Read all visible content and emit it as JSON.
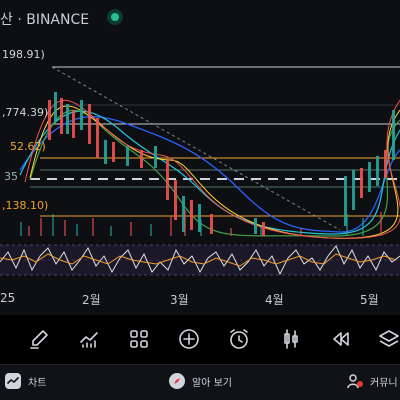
{
  "header": {
    "exchange": "산 · BINANCE"
  },
  "price_levels": [
    {
      "label": "198.91)",
      "color": "#d1d4dc"
    },
    {
      "label": ",774.39)",
      "color": "#d1d4dc"
    },
    {
      "label": "52.62)",
      "color": "#f0a030"
    },
    {
      "label": "35",
      "color": "#8fb7a0"
    },
    {
      "label": ",138.10)",
      "color": "#f0a030"
    }
  ],
  "time_axis": {
    "labels": [
      "25",
      "2월",
      "3월",
      "4월",
      "5월"
    ]
  },
  "toolbar": {
    "tools": [
      "brush-icon",
      "indicator-icon",
      "layout-grid-icon",
      "add-icon",
      "alarm-icon",
      "candlestick-icon",
      "replay-icon",
      "layers-icon"
    ]
  },
  "bottom_nav": {
    "chart_label": "차트",
    "ideas_label": "알아 보기",
    "community_label": "커뮤니"
  },
  "colors": {
    "background": "#0e0f13",
    "accent_live": "#22c28a",
    "level_orange": "#f0a030",
    "oscillator": "#7e57c2"
  }
}
